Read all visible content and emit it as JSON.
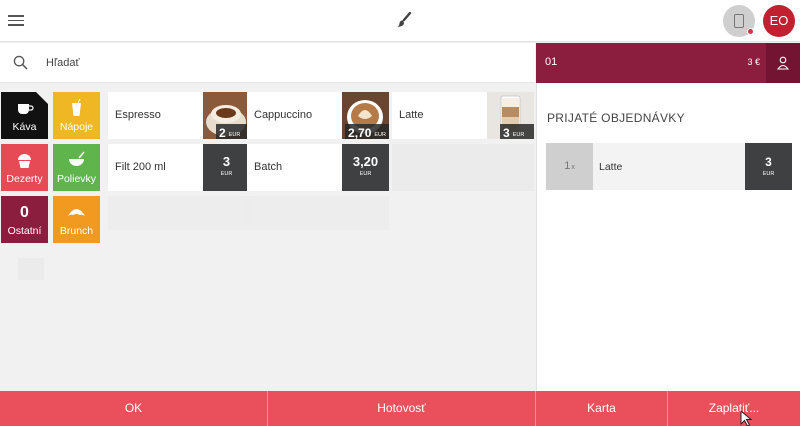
{
  "search": {
    "placeholder": "Hľadať"
  },
  "user": {
    "initials": "EO"
  },
  "colors": {
    "accent": "#8b1d3f",
    "action": "#e9505c",
    "kava": "#111111",
    "napoje": "#efb723",
    "dezerty": "#e64a55",
    "polievky": "#5fb54b",
    "ostatni": "#8b1d3f",
    "brunch": "#f19a1f"
  },
  "categories": [
    {
      "label": "Káva",
      "icon": "coffee-cup-icon"
    },
    {
      "label": "Nápoje",
      "icon": "drink-cup-icon"
    },
    {
      "label": "Dezerty",
      "icon": "cupcake-icon"
    },
    {
      "label": "Polievky",
      "icon": "soup-bowl-icon"
    },
    {
      "label": "Ostatní",
      "icon": "zero-digit",
      "glyph": "0"
    },
    {
      "label": "Brunch",
      "icon": "croissant-icon"
    }
  ],
  "products": [
    {
      "name": "Espresso",
      "price": "2",
      "currency": "EUR"
    },
    {
      "name": "Cappuccino",
      "price": "2,70",
      "currency": "EUR"
    },
    {
      "name": "Latte",
      "price": "3",
      "currency": "EUR"
    },
    {
      "name": "Filt 200 ml",
      "price": "3",
      "currency": "EUR"
    },
    {
      "name": "Batch",
      "price": "3,20",
      "currency": "EUR"
    }
  ],
  "order": {
    "number": "01",
    "total": "3 €",
    "section_title": "PRIJATÉ OBJEDNÁVKY",
    "items": [
      {
        "qty": "1",
        "qty_suffix": "x",
        "name": "Latte",
        "price": "3",
        "currency": "EUR"
      }
    ]
  },
  "actions": {
    "ok": "OK",
    "cash": "Hotovosť",
    "card": "Karta",
    "pay": "Zaplatiť..."
  }
}
